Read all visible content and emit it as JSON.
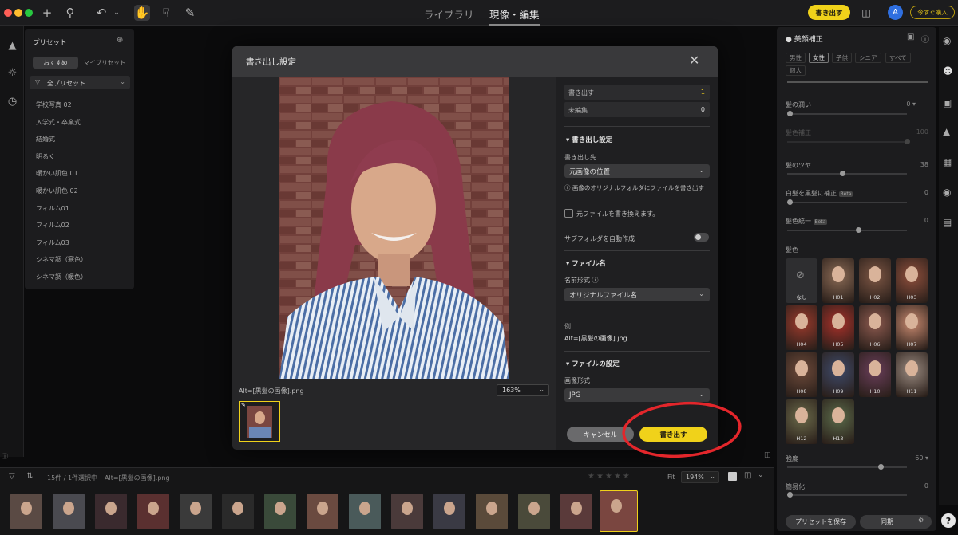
{
  "topbar": {
    "nav_library": "ライブラリ",
    "nav_develop": "現像・編集",
    "export_label": "書き出す",
    "avatar_letter": "A",
    "update_label": "今すぐ購入"
  },
  "presets": {
    "title": "プリセット",
    "tab_recommended": "おすすめ",
    "tab_my": "マイプリセット",
    "filter_label": "全プリセット",
    "items": [
      "学校写真 02",
      "入学式・卒業式",
      "結婚式",
      "明るく",
      "暖かい肌色 01",
      "暖かい肌色 02",
      "フィルム01",
      "フィルム02",
      "フィルム03",
      "シネマ調（寒色）",
      "シネマ調（暖色）"
    ]
  },
  "right_panel": {
    "title": "美顔補正",
    "chips": [
      "男性",
      "女性",
      "子供",
      "シニア",
      "すべて",
      "個人"
    ],
    "hair_volume_label": "髪の潤い",
    "hair_volume_value": "0",
    "hair_fill_label": "髪色補正",
    "hair_fill_value": "100",
    "hair_gloss_label": "髪のツヤ",
    "hair_gloss_value": "38",
    "gray_label": "白髪を黒髪に補正",
    "gray_value": "0",
    "unify_label": "髪色統一",
    "unify_value": "0",
    "beta": "Beta",
    "hair_color_label": "髪色",
    "none_label": "なし",
    "swatches": [
      "H01",
      "H02",
      "H03",
      "H04",
      "H05",
      "H06",
      "H07",
      "H08",
      "H09",
      "H10",
      "H11",
      "H12",
      "H13"
    ],
    "intensity_label": "強度",
    "intensity_value": "60",
    "smooth_label": "簡易化",
    "smooth_value": "0",
    "save_preset": "プリセットを保存",
    "sync": "同期"
  },
  "dialog": {
    "title": "書き出し設定",
    "export_count_label": "書き出す",
    "export_count": "1",
    "unedited_label": "未編集",
    "unedited_count": "0",
    "section_export": "書き出し設定",
    "dest_label": "書き出し先",
    "dest_value": "元画像の位置",
    "dest_note": "画像のオリジナルフォルダにファイルを書き出す",
    "overwrite_label": "元ファイルを書き換えます。",
    "subfolder_label": "サブフォルダを自動作成",
    "section_filename": "ファイル名",
    "name_format_label": "名前形式",
    "name_format_value": "オリジナルファイル名",
    "example_label": "例",
    "example_value": "Alt=[黒髪の画像].jpg",
    "section_file": "ファイルの設定",
    "image_format_label": "画像形式",
    "image_format_value": "JPG",
    "cancel": "キャンセル",
    "export": "書き出す",
    "preview_filename": "Alt=[黒髪の画像].png",
    "zoom": "163%"
  },
  "filmstrip": {
    "status": "15件 / 1件選択中",
    "filename": "Alt=[黒髪の画像].png",
    "fit": "Fit",
    "zoom": "194%"
  },
  "colors": {
    "accent": "#f0d21a",
    "dialog_bg": "#262628",
    "annotation": "#e3262b"
  }
}
